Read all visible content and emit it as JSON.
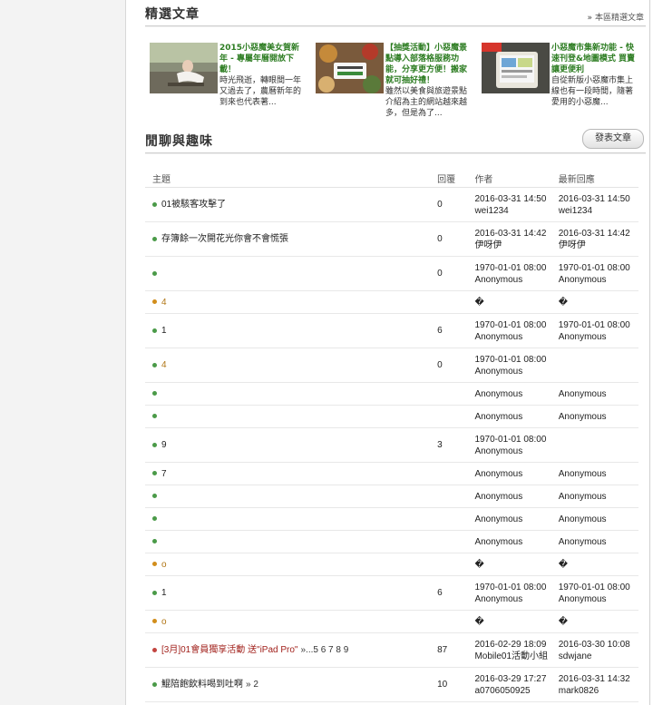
{
  "featured": {
    "title": "精選文章",
    "more_link": "本區精選文章",
    "articles": [
      {
        "title": "2015小惡魔美女賀新年 - 專屬年曆開放下載！",
        "excerpt": "時光飛逝，轉眼間一年又過去了，農曆新年的到來也代表著..."
      },
      {
        "title": "【抽獎活動】小惡魔景點導入部落格服務功能，分享更方便！搬家就可抽好禮！",
        "excerpt": "雖然以美食與旅遊景點介紹為主的網站越來越多，但是為了..."
      },
      {
        "title": "小惡魔市集新功能 - 快速刊登&地圖模式 買賣讓更便利",
        "excerpt": "自從新版小惡魔市集上線也有一段時間，隨著愛用的小惡魔..."
      }
    ]
  },
  "forum": {
    "title": "閒聊與趣味",
    "post_button": "發表文章",
    "columns": {
      "topic": "主題",
      "replies": "回覆",
      "author": "作者",
      "last_reply": "最新回應"
    },
    "rows": [
      {
        "status": "green",
        "style": "normal",
        "topic": "01被駭客攻擊了",
        "pages": "",
        "replies": "0",
        "author_date": "2016-03-31 14:50",
        "author": "wei1234",
        "last_date": "2016-03-31 14:50",
        "last_user": "wei1234"
      },
      {
        "status": "green",
        "style": "normal",
        "topic": "存簿餘一次開花光你會不會慌張",
        "pages": "",
        "replies": "0",
        "author_date": "2016-03-31 14:42",
        "author": "伊呀伊",
        "last_date": "2016-03-31 14:42",
        "last_user": "伊呀伊"
      },
      {
        "status": "green",
        "style": "normal",
        "topic": "",
        "pages": "",
        "replies": "0",
        "author_date": "1970-01-01 08:00",
        "author": "Anonymous",
        "last_date": "1970-01-01 08:00",
        "last_user": "Anonymous"
      },
      {
        "status": "orange",
        "style": "orange",
        "topic": "4",
        "pages": "",
        "replies": "",
        "author_date": "",
        "author": "�",
        "last_date": "",
        "last_user": "�"
      },
      {
        "status": "green",
        "style": "normal",
        "topic": "1",
        "pages": "",
        "replies": "6",
        "author_date": "1970-01-01 08:00",
        "author": "Anonymous",
        "last_date": "1970-01-01 08:00",
        "last_user": "Anonymous"
      },
      {
        "status": "green",
        "style": "orange",
        "topic": "4",
        "pages": "",
        "replies": "0",
        "author_date": "1970-01-01 08:00",
        "author": "Anonymous",
        "last_date": "",
        "last_user": ""
      },
      {
        "status": "green",
        "style": "normal",
        "topic": "",
        "pages": "",
        "replies": "",
        "author_date": "",
        "author": "Anonymous",
        "last_date": "",
        "last_user": "Anonymous"
      },
      {
        "status": "green",
        "style": "normal",
        "topic": "",
        "pages": "",
        "replies": "",
        "author_date": "",
        "author": "Anonymous",
        "last_date": "",
        "last_user": "Anonymous"
      },
      {
        "status": "green",
        "style": "normal",
        "topic": "9",
        "pages": "",
        "replies": "3",
        "author_date": "1970-01-01 08:00",
        "author": "Anonymous",
        "last_date": "",
        "last_user": ""
      },
      {
        "status": "green",
        "style": "normal",
        "topic": "7",
        "pages": "",
        "replies": "",
        "author_date": "",
        "author": "Anonymous",
        "last_date": "",
        "last_user": "Anonymous"
      },
      {
        "status": "green",
        "style": "normal",
        "topic": "",
        "pages": "",
        "replies": "",
        "author_date": "",
        "author": "Anonymous",
        "last_date": "",
        "last_user": "Anonymous"
      },
      {
        "status": "green",
        "style": "normal",
        "topic": "",
        "pages": "",
        "replies": "",
        "author_date": "",
        "author": "Anonymous",
        "last_date": "",
        "last_user": "Anonymous"
      },
      {
        "status": "green",
        "style": "normal",
        "topic": "",
        "pages": "",
        "replies": "",
        "author_date": "",
        "author": "Anonymous",
        "last_date": "",
        "last_user": "Anonymous"
      },
      {
        "status": "orange",
        "style": "orange",
        "topic": "o",
        "pages": "",
        "replies": "",
        "author_date": "",
        "author": "�",
        "last_date": "",
        "last_user": "�"
      },
      {
        "status": "green",
        "style": "normal",
        "topic": "1",
        "pages": "",
        "replies": "6",
        "author_date": "1970-01-01 08:00",
        "author": "Anonymous",
        "last_date": "1970-01-01 08:00",
        "last_user": "Anonymous"
      },
      {
        "status": "orange",
        "style": "orange",
        "topic": "o",
        "pages": "",
        "replies": "",
        "author_date": "",
        "author": "�",
        "last_date": "",
        "last_user": "�"
      },
      {
        "status": "red",
        "style": "red",
        "topic": "[3月]01會員獨享活動 送\"iPad Pro\"",
        "pages": "»...5 6 7 8 9",
        "replies": "87",
        "author_date": "2016-02-29 18:09",
        "author": "Mobile01活動小組",
        "last_date": "2016-03-30 10:08",
        "last_user": "sdwjane"
      },
      {
        "status": "green",
        "style": "normal",
        "topic": "鯤陪飽飲料喝到吐啊",
        "pages": "» 2",
        "replies": "10",
        "author_date": "2016-03-29 17:27",
        "author": "a0706050925",
        "last_date": "2016-03-31 14:32",
        "last_user": "mark0826"
      }
    ]
  }
}
